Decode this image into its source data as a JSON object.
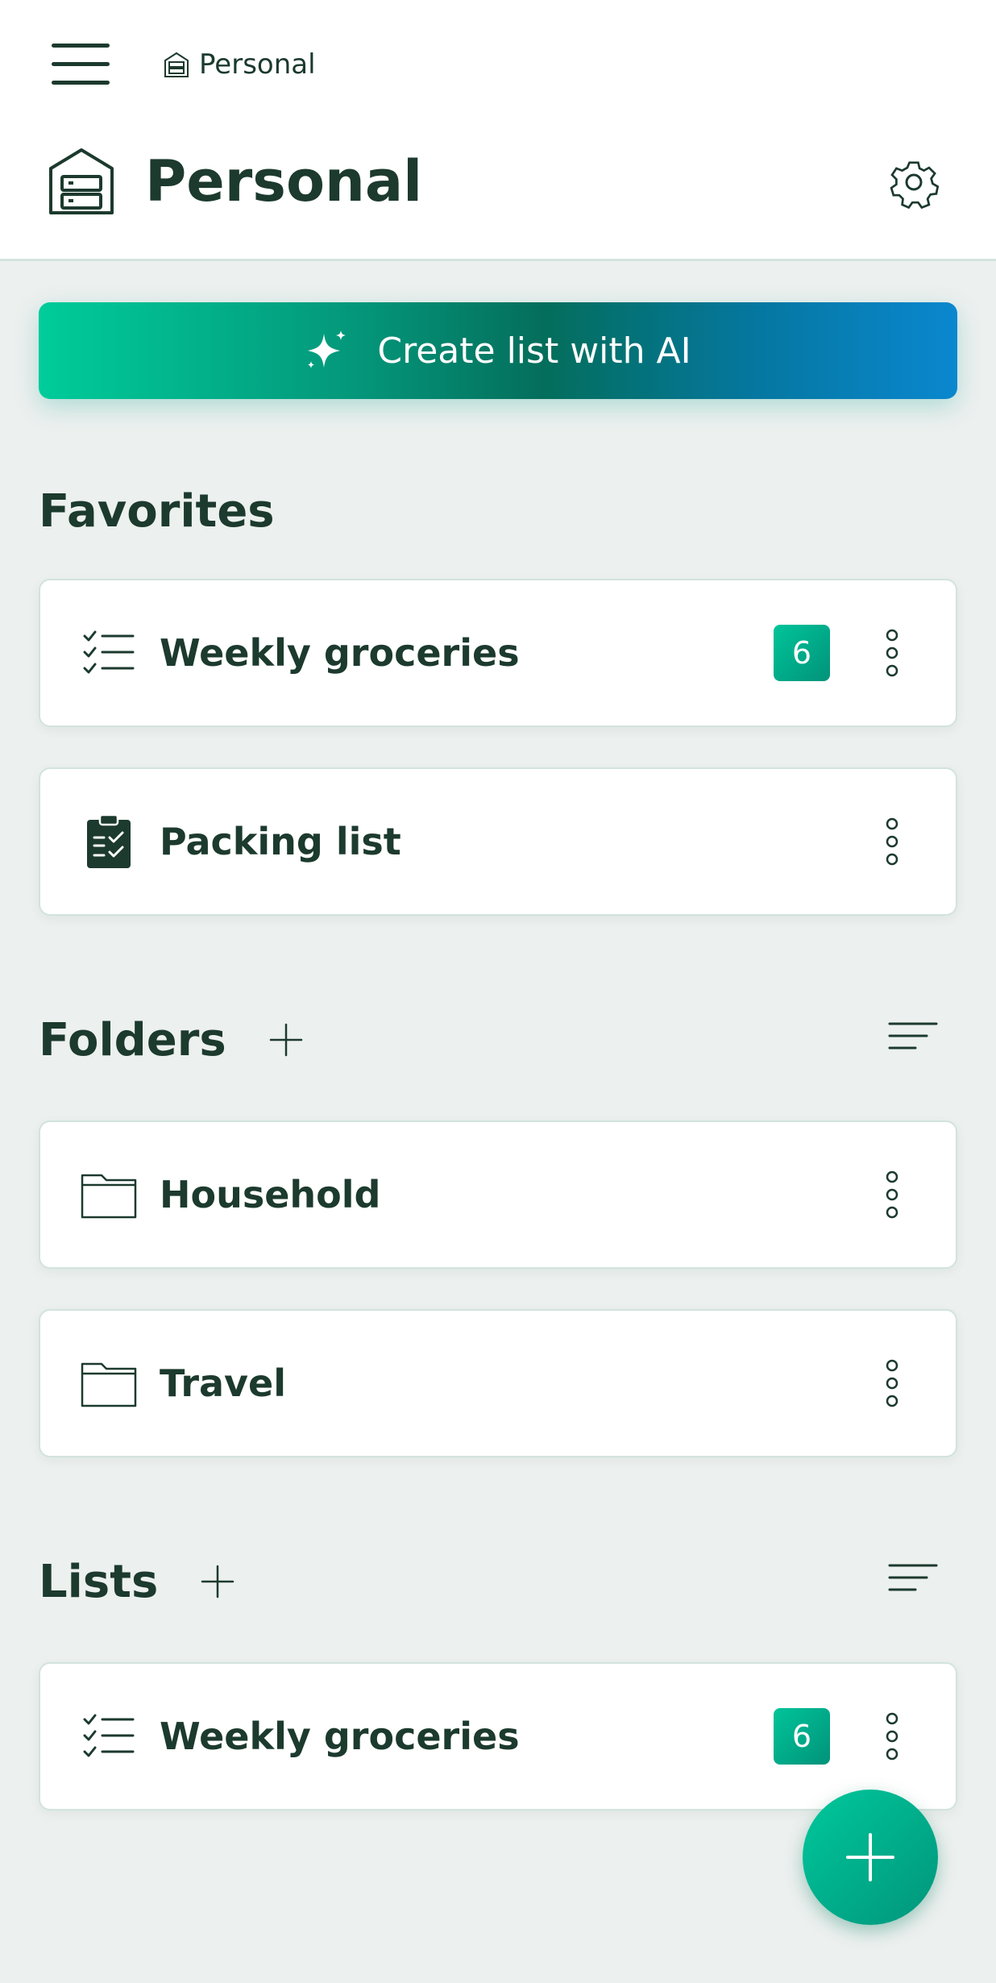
{
  "header": {
    "menu_icon": "hamburger-menu-icon",
    "breadcrumb": {
      "icon": "cabinet-icon",
      "label": "Personal"
    },
    "title": "Personal",
    "title_icon": "cabinet-icon",
    "settings_icon": "gear-icon"
  },
  "ai_button": {
    "icon": "sparkle-icon",
    "label": "Create list with AI"
  },
  "favorites": {
    "title": "Favorites",
    "items": [
      {
        "icon": "checklist-icon",
        "label": "Weekly groceries",
        "badge": "6"
      },
      {
        "icon": "clipboard-check-icon",
        "label": "Packing list"
      }
    ]
  },
  "folders": {
    "title": "Folders",
    "add_icon": "plus-icon",
    "sort_icon": "sort-icon",
    "items": [
      {
        "icon": "folder-icon",
        "label": "Household"
      },
      {
        "icon": "folder-icon",
        "label": "Travel"
      }
    ]
  },
  "lists": {
    "title": "Lists",
    "add_icon": "plus-icon",
    "sort_icon": "sort-icon",
    "items": [
      {
        "icon": "checklist-icon",
        "label": "Weekly groceries",
        "badge": "6"
      }
    ]
  },
  "fab": {
    "icon": "plus-icon"
  },
  "colors": {
    "primary": "#01a884",
    "text": "#1c3a2e",
    "background": "#ecf0ef",
    "gradient_start": "#00cc9a",
    "gradient_end": "#0a87cf"
  }
}
